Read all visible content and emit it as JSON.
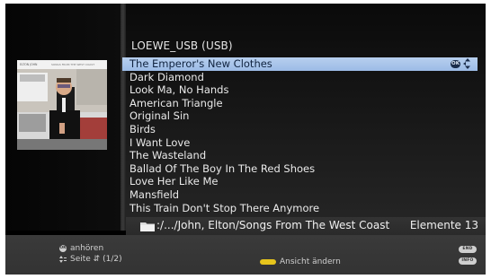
{
  "source": {
    "title": "LOEWE_USB (USB)"
  },
  "album_art": {
    "artist_text": "ELTON JOHN",
    "album_text": "SONGS FROM THE WEST COAST"
  },
  "tracks": [
    "The Emperor's New Clothes",
    "Dark Diamond",
    "Look Ma, No Hands",
    "American Triangle",
    "Original Sin",
    "Birds",
    "I Want Love",
    "The Wasteland",
    "Ballad Of The Boy In The Red Shoes",
    "Love Her Like Me",
    "Mansfield",
    "This Train Don't Stop There Anymore"
  ],
  "selected_icons": {
    "ok_badge": "OK",
    "arrows_icon": "up-down-arrows-icon"
  },
  "path_bar": {
    "path": ":/.../John, Elton/Songs From The West Coast",
    "count": "Elemente 13",
    "icon": "folder-icon"
  },
  "footer": {
    "ok_label": "OK",
    "listen_label": "anhören",
    "page_label": "Seite ⇵ (1/2)",
    "view_label": "Ansicht ändern",
    "end_key": "END",
    "info_key": "INFO"
  },
  "colors": {
    "selection": "#a9c6ec",
    "yellow_key": "#e7c51c",
    "background": "#000000",
    "footer": "#363636"
  }
}
